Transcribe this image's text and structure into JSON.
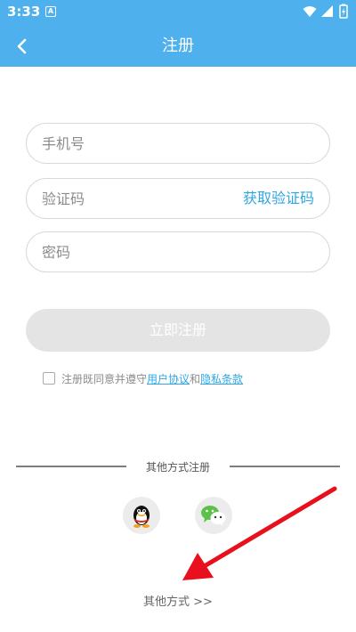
{
  "status_bar": {
    "time": "3:33",
    "app_icon_letter": "A"
  },
  "header": {
    "title": "注册"
  },
  "form": {
    "phone_placeholder": "手机号",
    "code_placeholder": "验证码",
    "get_code_label": "获取验证码",
    "password_placeholder": "密码",
    "register_label": "立即注册"
  },
  "agreement": {
    "prefix": "注册既同意并遵守",
    "terms_link": "用户协议",
    "and": "和",
    "privacy_link": "隐私条款",
    "checked": false
  },
  "social": {
    "heading": "其他方式注册",
    "options": [
      "qq-icon",
      "wechat-icon"
    ]
  },
  "footer": {
    "other_ways_label": "其他方式 >>"
  },
  "colors": {
    "primary": "#4eb1ed",
    "link": "#2ea6e3",
    "disabled_button": "#e4e4e4",
    "annotation_arrow": "#e8101c"
  }
}
